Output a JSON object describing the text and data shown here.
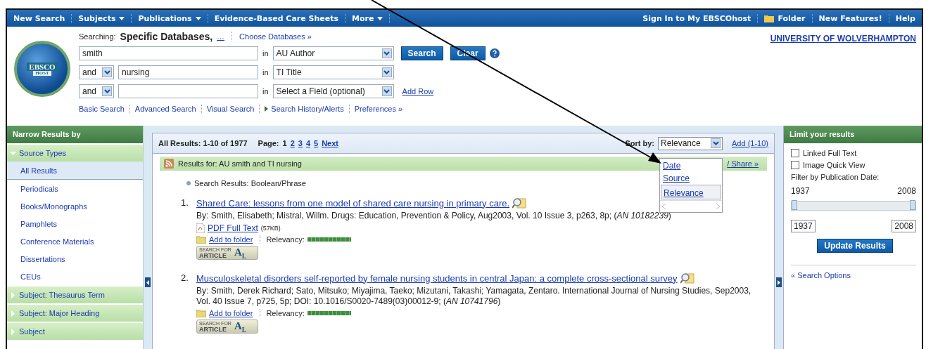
{
  "top_nav": {
    "left": [
      {
        "label": "New Search",
        "menu": false
      },
      {
        "label": "Subjects",
        "menu": true
      },
      {
        "label": "Publications",
        "menu": true
      },
      {
        "label": "Evidence-Based Care Sheets",
        "menu": false
      },
      {
        "label": "More",
        "menu": true
      }
    ],
    "right": [
      {
        "label": "Sign In to My EBSCOhost",
        "kind": "link"
      },
      {
        "label": "Folder",
        "kind": "folder"
      },
      {
        "label": "New Features!",
        "kind": "link"
      },
      {
        "label": "Help",
        "kind": "link"
      }
    ]
  },
  "logo": {
    "top": "EBSCO",
    "bottom": "HOST"
  },
  "searching": {
    "label": "Searching:",
    "databases": "Specific Databases,",
    "more": "…",
    "choose": "Choose Databases »"
  },
  "institution": "UNIVERSITY OF WOLVERHAMPTON",
  "search_rows": [
    {
      "operator": null,
      "value": "smith",
      "in": "in",
      "field": "AU Author"
    },
    {
      "operator": "and",
      "value": "nursing",
      "in": "in",
      "field": "TI Title"
    },
    {
      "operator": "and",
      "value": "",
      "in": "in",
      "field": "Select a Field (optional)"
    }
  ],
  "search_button": "Search",
  "clear_button": "Clear",
  "add_row": "Add Row",
  "search_links": [
    {
      "label": "Basic Search",
      "arrow": false
    },
    {
      "label": "Advanced Search",
      "arrow": false
    },
    {
      "label": "Visual Search",
      "arrow": false
    },
    {
      "label": "Search History/Alerts",
      "arrow": true
    },
    {
      "label": "Preferences »",
      "arrow": false
    }
  ],
  "sidebar": {
    "title": "Narrow Results by",
    "sections": [
      {
        "label": "Source Types",
        "expanded": true,
        "children": [
          {
            "label": "All Results",
            "selected": true
          },
          {
            "label": "Periodicals",
            "selected": false
          },
          {
            "label": "Books/Monographs",
            "selected": false
          },
          {
            "label": "Pamphlets",
            "selected": false
          },
          {
            "label": "Conference Materials",
            "selected": false
          },
          {
            "label": "Dissertations",
            "selected": false
          },
          {
            "label": "CEUs",
            "selected": false
          }
        ]
      },
      {
        "label": "Subject: Thesaurus Term",
        "expanded": false
      },
      {
        "label": "Subject: Major Heading",
        "expanded": false
      },
      {
        "label": "Subject",
        "expanded": false
      }
    ]
  },
  "results_header": {
    "summary": "All Results: 1-10 of 1977",
    "page_label": "Page:",
    "pages": [
      {
        "label": "1",
        "selected": true
      },
      {
        "label": "2",
        "selected": false
      },
      {
        "label": "3",
        "selected": false
      },
      {
        "label": "4",
        "selected": false
      },
      {
        "label": "5",
        "selected": false
      },
      {
        "label": "Next",
        "selected": false
      }
    ],
    "sort_label": "Sort by:",
    "sort_value": "Relevance",
    "add": "Add (1-10)"
  },
  "sort_menu": {
    "options": [
      {
        "label": "Date",
        "selected": false
      },
      {
        "label": "Source",
        "selected": false
      },
      {
        "label": "Relevance",
        "selected": true
      }
    ]
  },
  "results_for": {
    "text": "Results for:  AU smith and TI nursing",
    "share": "/ Share »"
  },
  "search_mode": "Search Results: Boolean/Phrase",
  "results": [
    {
      "number": "1.",
      "title": "Shared Care: lessons from one model of shared care nursing in primary care.",
      "byline": "By: Smith, Elisabeth; Mistral, Willm. Drugs: Education, Prevention & Policy, Aug2003, Vol. 10 Issue 3, p263, 8p; (*AN 10182239*)",
      "pdf": {
        "label": "PDF Full Text",
        "size": "(57KB)"
      },
      "add_folder": "Add to folder",
      "relevancy_label": "Relevancy:",
      "relevancy": {
        "level": 1
      },
      "article_button": {
        "line1": "SEARCH FOR",
        "line2": "ARTICLE",
        "mark": "A",
        "mark_sub": "L"
      }
    },
    {
      "number": "2.",
      "title": "Musculoskeletal disorders self-reported by female nursing students in central Japan: a complete cross-sectional survey",
      "byline": "By: Smith, Derek Richard; Sato, Mitsuko; Miyajima, Taeko; Mizutani, Takashi; Yamagata, Zentaro. International Journal of Nursing Studies, Sep2003, Vol. 40 Issue 7, p725, 5p; DOI: 10.1016/S0020-7489(03)00012-9; (*AN 10741796*)",
      "add_folder": "Add to folder",
      "relevancy_label": "Relevancy:",
      "relevancy": {
        "level": 1
      },
      "article_button": {
        "line1": "SEARCH FOR",
        "line2": "ARTICLE",
        "mark": "A",
        "mark_sub": "L"
      }
    }
  ],
  "limit": {
    "title": "Limit your results",
    "options": [
      {
        "label": "Linked Full Text",
        "checked": false
      },
      {
        "label": "Image Quick View",
        "checked": false
      }
    ],
    "filter_label": "Filter by Publication Date:",
    "date_slider": {
      "level": 1
    },
    "range_min": "1937",
    "range_max": "2008",
    "from": "1937",
    "to": "2008",
    "update": "Update Results",
    "search_options": "« Search Options"
  }
}
